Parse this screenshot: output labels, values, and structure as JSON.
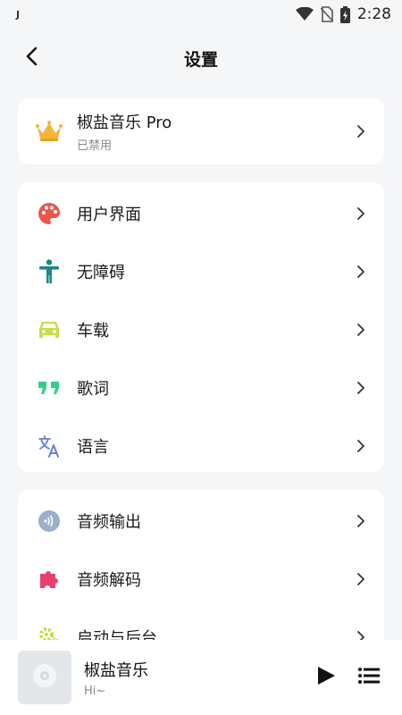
{
  "status_bar": {
    "left_glyph": "J",
    "time": "2:28",
    "icons": [
      "wifi-icon",
      "no-sim-icon",
      "battery-charging-icon"
    ]
  },
  "header": {
    "title": "设置",
    "back_icon": "chevron-left-icon"
  },
  "pro": {
    "title": "椒盐音乐 Pro",
    "subtitle": "已禁用",
    "icon": "crown-icon"
  },
  "group1": [
    {
      "label": "用户界面",
      "icon": "palette-icon",
      "color": "#e9574f"
    },
    {
      "label": "无障碍",
      "icon": "accessibility-icon",
      "color": "#1b8a86"
    },
    {
      "label": "车载",
      "icon": "car-icon",
      "color": "#c6de4a"
    },
    {
      "label": "歌词",
      "icon": "quote-icon",
      "color": "#2fd08a"
    },
    {
      "label": "语言",
      "icon": "translate-icon",
      "color": "#6b7fd8"
    }
  ],
  "group2": [
    {
      "label": "音频输出",
      "icon": "audio-output-icon",
      "color": "#9bb0c8"
    },
    {
      "label": "音频解码",
      "icon": "puzzle-icon",
      "color": "#e6416d"
    },
    {
      "label": "启动与后台",
      "icon": "gear-icon",
      "color": "#c6de4a"
    }
  ],
  "player": {
    "title": "椒盐音乐",
    "subtitle": "Hi~",
    "cover_icon": "disc-icon",
    "play_icon": "play-icon",
    "queue_icon": "playlist-icon"
  }
}
